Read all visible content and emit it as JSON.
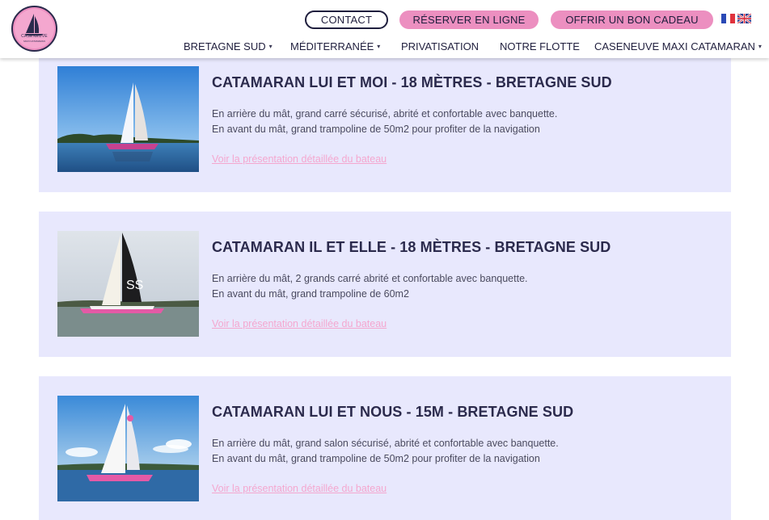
{
  "header": {
    "logo_text": "CASENEUVE",
    "logo_subtext": "MAXI CATAMARAN",
    "contact_label": "CONTACT",
    "reserve_label": "RÉSERVER EN LIGNE",
    "gift_label": "OFFRIR UN BON CADEAU",
    "nav": [
      {
        "label": "BRETAGNE SUD",
        "has_dropdown": true
      },
      {
        "label": "MÉDITERRANÉE",
        "has_dropdown": true
      },
      {
        "label": "PRIVATISATION",
        "has_dropdown": false
      },
      {
        "label": "NOTRE FLOTTE",
        "has_dropdown": false
      },
      {
        "label": "CASENEUVE MAXI CATAMARAN",
        "has_dropdown": true
      }
    ],
    "caret": "▾"
  },
  "boats": [
    {
      "title": "CATAMARAN LUI ET MOI - 18 MÈTRES - BRETAGNE SUD",
      "desc_line1": "En arrière du mât, grand carré sécurisé, abrité et confortable avec banquette.",
      "desc_line2": "En avant du mât, grand trampoline de 50m2 pour profiter de la navigation",
      "link": "Voir la présentation détaillée du bateau"
    },
    {
      "title": "CATAMARAN IL ET ELLE - 18 MÈTRES - BRETAGNE SUD",
      "desc_line1": "En arrière du mât, 2 grands carré abrité et confortable avec banquette.",
      "desc_line2": "En avant du mât, grand trampoline de 60m2",
      "link": "Voir la présentation détaillée du bateau"
    },
    {
      "title": "CATAMARAN LUI ET NOUS - 15M - BRETAGNE SUD",
      "desc_line1": "En arrière du mât, grand salon sécurisé, abrité et confortable avec banquette.",
      "desc_line2": "En avant du mât, grand trampoline de 50m2 pour profiter de la navigation",
      "link": "Voir la présentation détaillée du bateau"
    }
  ],
  "colors": {
    "accent_pink": "#ec8fc0",
    "card_bg": "#e8e8fd",
    "title_navy": "#2b2a4c",
    "link_pink": "#f4a7cf"
  },
  "icons": [
    "france-flag-icon",
    "uk-flag-icon",
    "dropdown-caret-icon",
    "sailboat-logo-icon"
  ]
}
